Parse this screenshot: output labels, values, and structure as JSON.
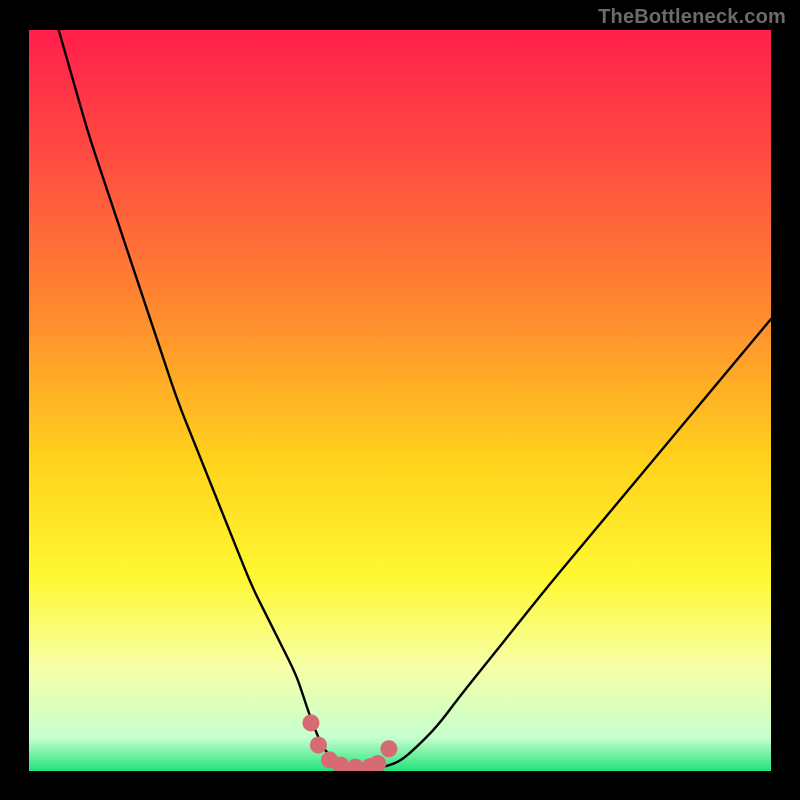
{
  "attribution": "TheBottleneck.com",
  "colors": {
    "frame": "#000000",
    "curve": "#000000",
    "marker": "#d76b74",
    "gradient_stops": [
      {
        "offset": 0.0,
        "color": "#ff1f4b"
      },
      {
        "offset": 0.18,
        "color": "#ff4e41"
      },
      {
        "offset": 0.38,
        "color": "#ff8a2f"
      },
      {
        "offset": 0.58,
        "color": "#ffd21c"
      },
      {
        "offset": 0.74,
        "color": "#fff833"
      },
      {
        "offset": 0.86,
        "color": "#f6ffa7"
      },
      {
        "offset": 0.955,
        "color": "#c6ffce"
      },
      {
        "offset": 1.0,
        "color": "#23e27a"
      }
    ]
  },
  "chart_data": {
    "type": "line",
    "title": "",
    "xlabel": "",
    "ylabel": "",
    "xlim": [
      0,
      100
    ],
    "ylim": [
      0,
      100
    ],
    "grid": false,
    "legend": false,
    "series": [
      {
        "name": "bottleneck-curve",
        "x": [
          4,
          6,
          8,
          10,
          12,
          14,
          16,
          18,
          20,
          22,
          24,
          26,
          28,
          30,
          32,
          34,
          36,
          37,
          38,
          39,
          40,
          42,
          44,
          46,
          47,
          48,
          50,
          52,
          55,
          58,
          62,
          66,
          70,
          75,
          80,
          85,
          90,
          95,
          100
        ],
        "y": [
          100,
          93,
          86,
          80,
          74,
          68,
          62,
          56,
          50,
          45,
          40,
          35,
          30,
          25,
          21,
          17,
          13,
          10,
          7,
          4.5,
          2.5,
          1.2,
          0.6,
          0.4,
          0.4,
          0.6,
          1.3,
          3,
          6,
          10,
          15,
          20,
          25,
          31,
          37,
          43,
          49,
          55,
          61
        ]
      }
    ],
    "markers": {
      "name": "trough-markers",
      "x": [
        38,
        39,
        40.5,
        42,
        44,
        46,
        47,
        48.5
      ],
      "y": [
        6.5,
        3.5,
        1.5,
        0.8,
        0.5,
        0.6,
        1.0,
        3.0
      ]
    }
  }
}
